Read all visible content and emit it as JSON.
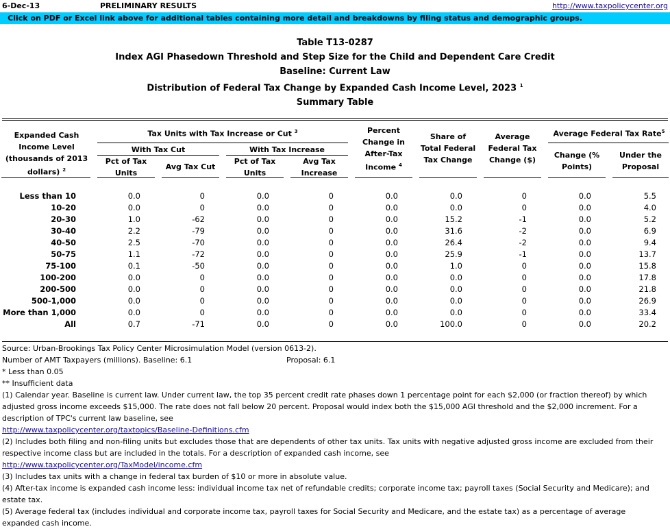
{
  "header": {
    "date": "6-Dec-13",
    "status": "PRELIMINARY RESULTS",
    "link": "http://www.taxpolicycenter.org",
    "banner": "Click on PDF or Excel link above for additional tables containing more detail and breakdowns by filing status and demographic groups.",
    "banner_color": "#00ccff"
  },
  "titles": {
    "table_id": "Table T13-0287",
    "title": "Index AGI Phasedown Threshold and Step Size for the Child and Dependent Care Credit",
    "baseline": "Baseline: Current Law",
    "distribution": "Distribution of Federal Tax Change by Expanded Cash Income Level, 2023",
    "distribution_sup": "1",
    "summary": "Summary Table"
  },
  "columns": {
    "income_level": "Expanded Cash Income Level (thousands of 2013 dollars)",
    "income_level_sup": "2",
    "tax_units_group": "Tax Units with Tax Increase or Cut",
    "tax_units_group_sup": "3",
    "with_tax_cut": "With Tax Cut",
    "with_tax_increase": "With Tax Increase",
    "cut_pct": "Pct of Tax Units",
    "cut_avg": "Avg Tax Cut",
    "inc_pct": "Pct of Tax Units",
    "inc_avg": "Avg Tax Increase",
    "pct_change_after_tax": "Percent Change in After-Tax Income",
    "pct_change_after_tax_sup": "4",
    "share_total": "Share of Total Federal Tax Change",
    "avg_fed_change": "Average Federal Tax Change ($)",
    "avg_rate_group": "Average Federal Tax Rate",
    "avg_rate_group_sup": "5",
    "rate_change": "Change (% Points)",
    "rate_under": "Under the Proposal"
  },
  "rows": [
    {
      "label": "Less than 10",
      "v": [
        "0.0",
        "0",
        "0.0",
        "0",
        "0.0",
        "0.0",
        "0",
        "0.0",
        "5.5"
      ]
    },
    {
      "label": "10-20",
      "v": [
        "0.0",
        "0",
        "0.0",
        "0",
        "0.0",
        "0.0",
        "0",
        "0.0",
        "4.0"
      ]
    },
    {
      "label": "20-30",
      "v": [
        "1.0",
        "-62",
        "0.0",
        "0",
        "0.0",
        "15.2",
        "-1",
        "0.0",
        "5.2"
      ]
    },
    {
      "label": "30-40",
      "v": [
        "2.2",
        "-79",
        "0.0",
        "0",
        "0.0",
        "31.6",
        "-2",
        "0.0",
        "6.9"
      ]
    },
    {
      "label": "40-50",
      "v": [
        "2.5",
        "-70",
        "0.0",
        "0",
        "0.0",
        "26.4",
        "-2",
        "0.0",
        "9.4"
      ]
    },
    {
      "label": "50-75",
      "v": [
        "1.1",
        "-72",
        "0.0",
        "0",
        "0.0",
        "25.9",
        "-1",
        "0.0",
        "13.7"
      ]
    },
    {
      "label": "75-100",
      "v": [
        "0.1",
        "-50",
        "0.0",
        "0",
        "0.0",
        "1.0",
        "0",
        "0.0",
        "15.8"
      ]
    },
    {
      "label": "100-200",
      "v": [
        "0.0",
        "0",
        "0.0",
        "0",
        "0.0",
        "0.0",
        "0",
        "0.0",
        "17.8"
      ]
    },
    {
      "label": "200-500",
      "v": [
        "0.0",
        "0",
        "0.0",
        "0",
        "0.0",
        "0.0",
        "0",
        "0.0",
        "21.8"
      ]
    },
    {
      "label": "500-1,000",
      "v": [
        "0.0",
        "0",
        "0.0",
        "0",
        "0.0",
        "0.0",
        "0",
        "0.0",
        "26.9"
      ]
    },
    {
      "label": "More than 1,000",
      "v": [
        "0.0",
        "0",
        "0.0",
        "0",
        "0.0",
        "0.0",
        "0",
        "0.0",
        "33.4"
      ]
    },
    {
      "label": "All",
      "v": [
        "0.7",
        "-71",
        "0.0",
        "0",
        "0.0",
        "100.0",
        "0",
        "0.0",
        "20.2"
      ]
    }
  ],
  "notes": {
    "source": "Source: Urban-Brookings Tax Policy Center Microsimulation Model (version 0613-2).",
    "amt_label": "Number of AMT Taxpayers (millions).  Baseline: 6.1",
    "amt_proposal": "Proposal: 6.1",
    "less_than": "* Less than 0.05",
    "insufficient": "** Insufficient data",
    "n1": "(1) Calendar year. Baseline is current law. Under current law, the top 35 percent credit rate phases down 1 percentage point for each $2,000 (or fraction thereof) by which adjusted gross income exceeds $15,000. The rate does not fall below 20 percent. Proposal would index both the $15,000 AGI threshold and the $2,000 increment.  For a description of TPC's current law baseline, see",
    "n1_link": "http://www.taxpolicycenter.org/taxtopics/Baseline-Definitions.cfm",
    "n2": "(2) Includes both filing and non-filing units but excludes those that are dependents of other tax units. Tax units with negative adjusted gross income are excluded from their respective income class but are included in the totals. For a description of expanded cash income, see",
    "n2_link": "http://www.taxpolicycenter.org/TaxModel/income.cfm",
    "n3": "(3) Includes tax units with a change in federal tax burden of $10 or more in absolute value.",
    "n4": "(4) After-tax income is expanded cash income less: individual income tax net of refundable credits; corporate income tax; payroll taxes (Social Security and Medicare); and estate tax.",
    "n5": "(5) Average federal tax (includes individual and corporate income tax, payroll taxes for Social Security and Medicare, and the estate tax) as a percentage of average expanded cash income."
  }
}
